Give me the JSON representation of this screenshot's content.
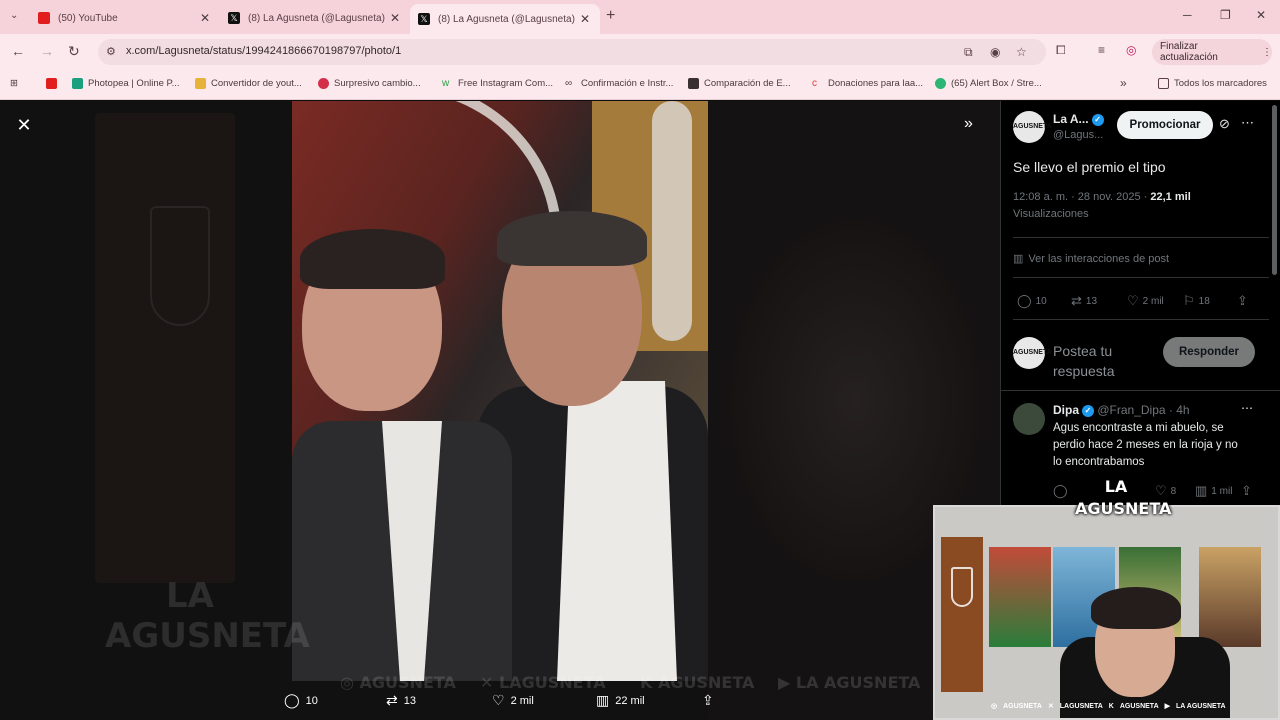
{
  "browser": {
    "tabs": [
      {
        "title": "(50) YouTube",
        "favicon": "youtube-icon"
      },
      {
        "title": "(8) La Agusneta (@Lagusneta)",
        "favicon": "x-icon"
      },
      {
        "title": "(8) La Agusneta (@Lagusneta)",
        "favicon": "x-icon"
      }
    ],
    "url": "x.com/Lagusneta/status/1994241866670198797/photo/1",
    "update_label": "Finalizar actualización",
    "bookmarks": [
      "Photopea | Online P...",
      "Convertidor de yout...",
      "Surpresivo cambio...",
      "Free Instagram Com...",
      "Confirmación e Instr...",
      "Comparación de E...",
      "Donaciones para laa...",
      "(65) Alert Box / Stre..."
    ],
    "all_bookmarks": "Todos los marcadores"
  },
  "viewer": {
    "watermark_text": "AGUSNETA",
    "watermark_logo_top": "LA",
    "watermark_logo_bottom": "AGUSNETA",
    "watermark_channel": "LA AGUSNETA",
    "actions": {
      "replies": "10",
      "reposts": "13",
      "likes": "2 mil",
      "views": "22 mil"
    }
  },
  "post": {
    "author_name": "La A...",
    "author_handle": "@Lagus...",
    "avatar_label": "AGUSNETA",
    "promote_label": "Promocionar",
    "text": "Se llevo el premio el tipo",
    "timestamp": "12:08 a. m. · 28 nov. 2025 ·",
    "views_count": "22,1 mil",
    "views_label": "Visualizaciones",
    "interactions_link": "Ver las interacciones de post",
    "stats": {
      "replies": "10",
      "reposts": "13",
      "likes": "2 mil",
      "bookmarks": "18"
    },
    "reply_placeholder_1": "Postea tu",
    "reply_placeholder_2": "respuesta",
    "reply_button": "Responder"
  },
  "reply": {
    "author_name": "Dipa",
    "author_handle": "@Fran_Dipa",
    "time": "· 4h",
    "text_lines": [
      "Agus encontraste a mi abuelo, se",
      "perdio hace 2 meses en la rioja y no",
      "lo encontrabamos"
    ],
    "likes": "8",
    "views": "1 mil"
  },
  "webcam": {
    "logo_top": "LA",
    "logo_bottom": "AGUSNETA",
    "socials": [
      "AGUSNETA",
      "LAGUSNETA",
      "AGUSNETA",
      "LA AGUSNETA"
    ]
  },
  "colors": {
    "accent": "#1d9bf0",
    "tabstrip": "#f6d3db",
    "toolbar": "#fbe9ed"
  }
}
